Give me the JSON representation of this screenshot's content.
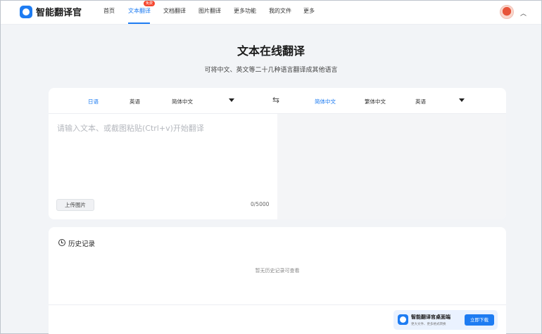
{
  "brand": {
    "name": "智能翻译官"
  },
  "nav": {
    "items": [
      "首页",
      "文本翻译",
      "文档翻译",
      "图片翻译",
      "更多功能",
      "我的文件",
      "更多"
    ],
    "active_badge": "免费"
  },
  "hero": {
    "title": "文本在线翻译",
    "subtitle": "可将中文、英文等二十几种语言翻译成其他语言"
  },
  "translator": {
    "source_langs": [
      "日语",
      "英语",
      "简体中文"
    ],
    "target_langs": [
      "简体中文",
      "繁体中文",
      "英语"
    ],
    "input_placeholder": "请输入文本、或截图粘贴(Ctrl+v)开始翻译",
    "upload_label": "上传图片",
    "char_count": "0/5000"
  },
  "history": {
    "title": "历史记录",
    "empty_text": "暂无历史记录可查看"
  },
  "promo": {
    "title": "智能翻译官桌面端",
    "subtitle": "更大文件、更多格式转换",
    "button_label": "立即下载"
  },
  "colors": {
    "accent": "#1e7cf2",
    "badge": "#f5462e",
    "background": "#f2f4f7"
  }
}
